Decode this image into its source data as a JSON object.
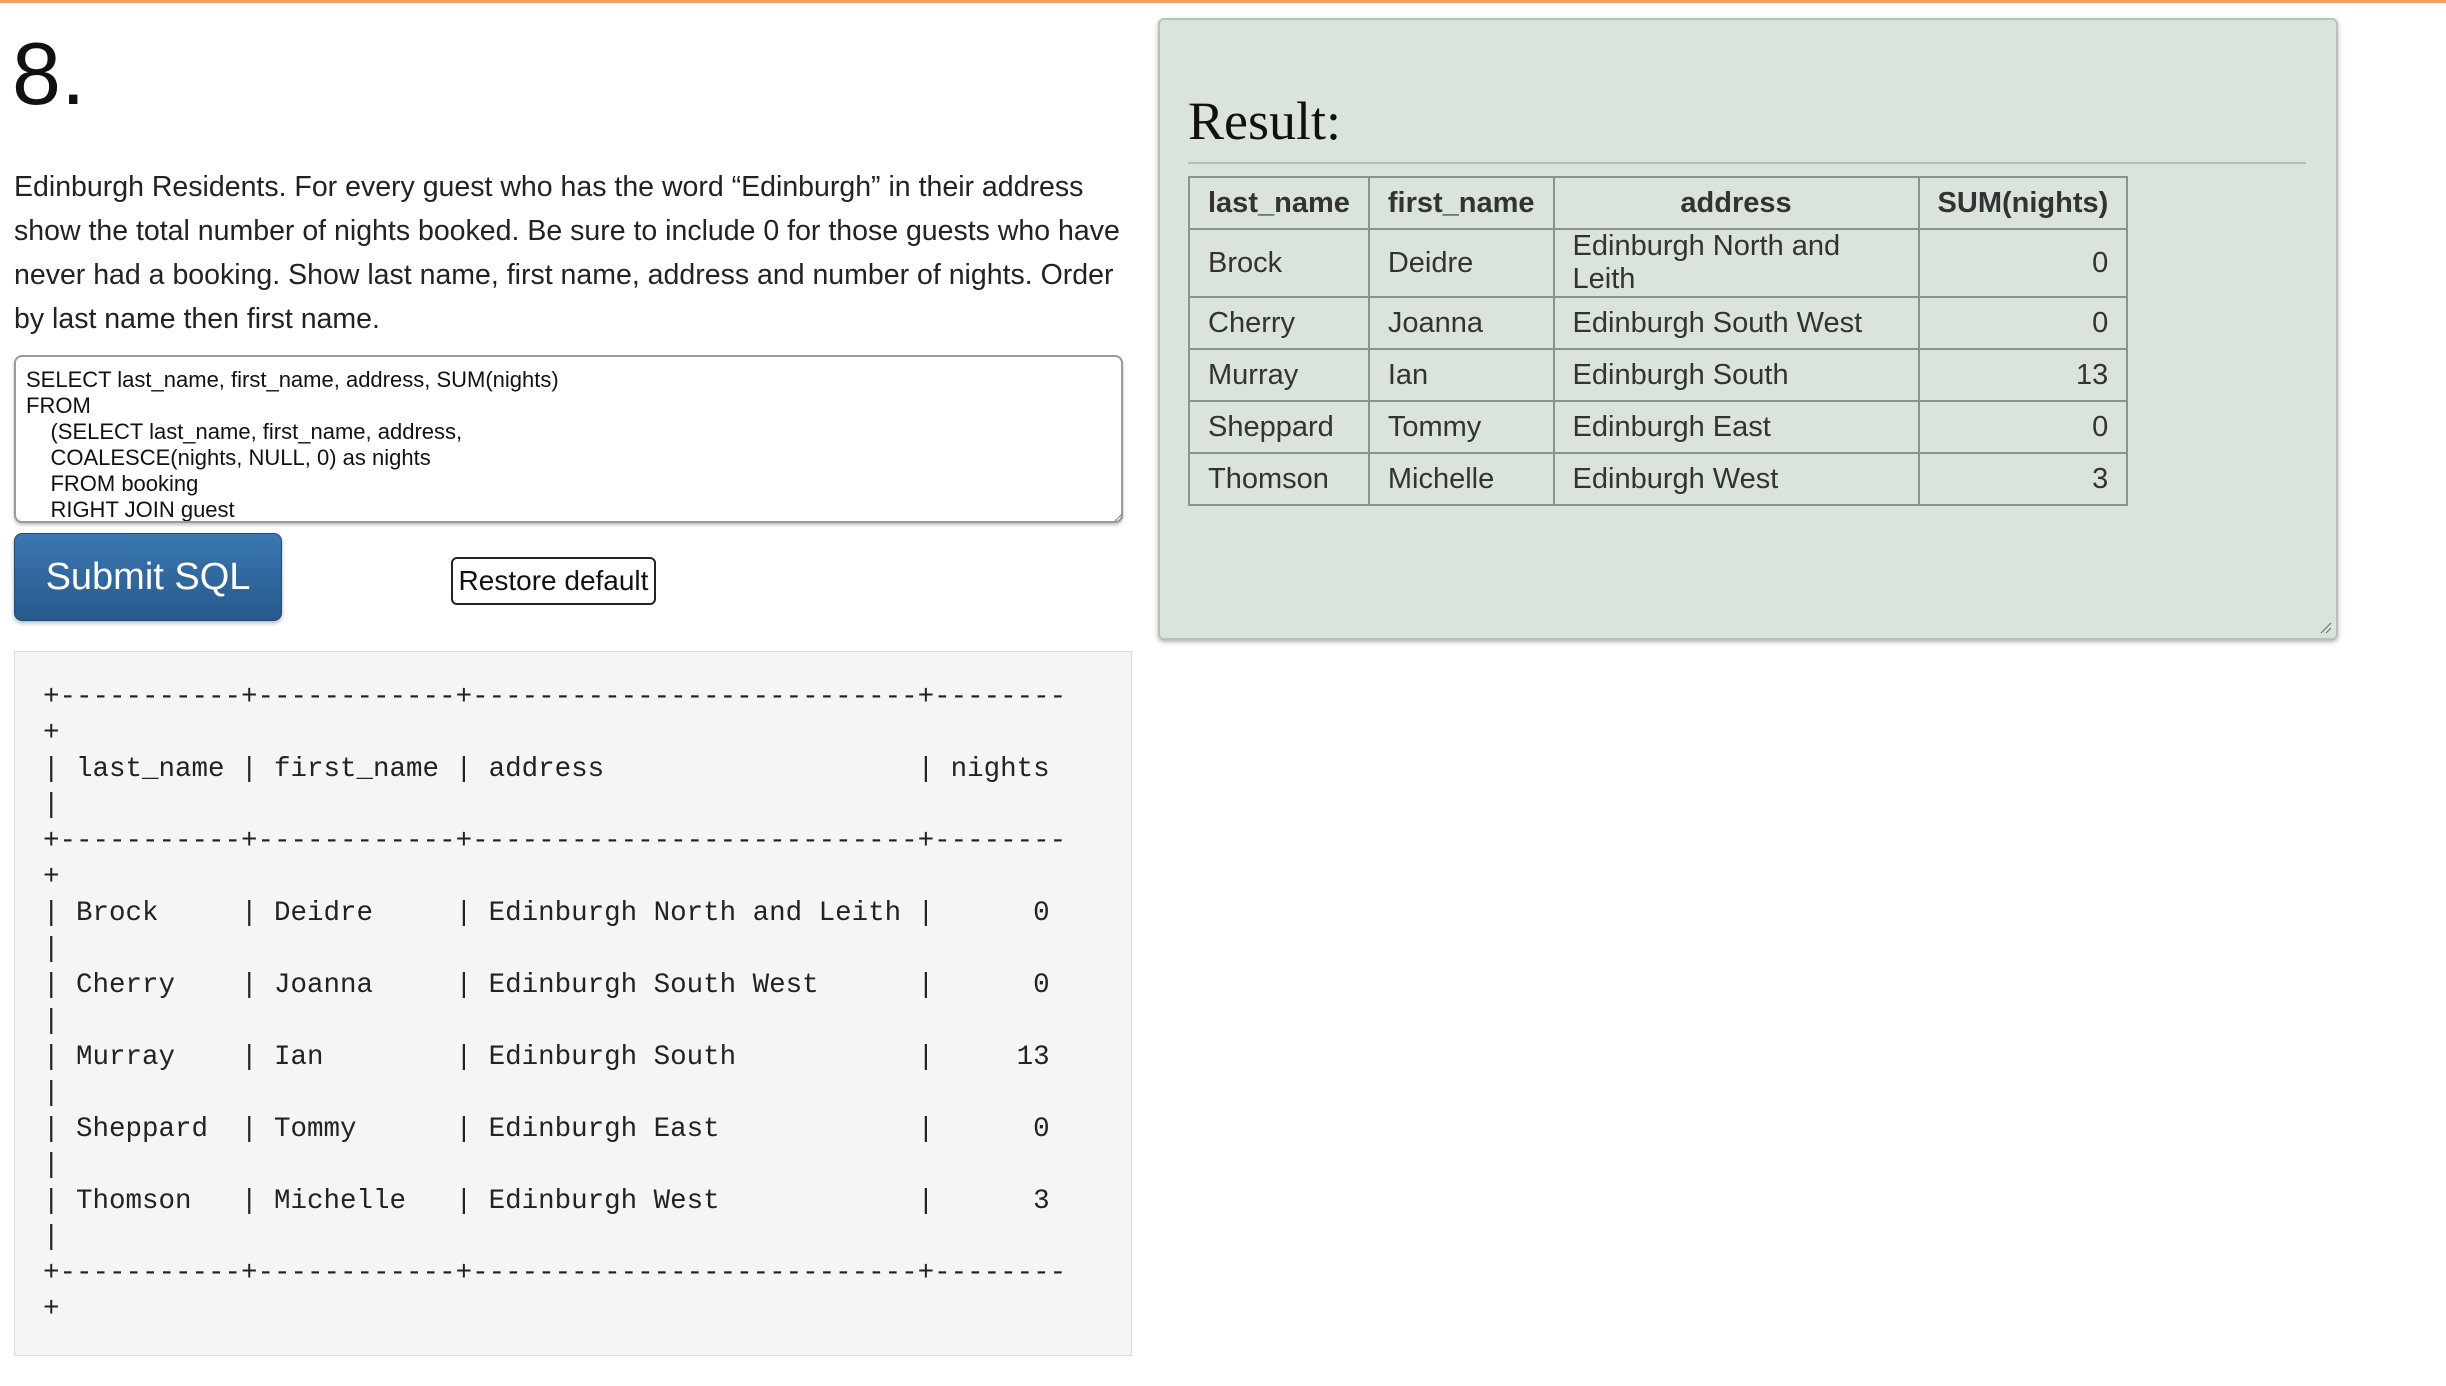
{
  "question": {
    "number": "8.",
    "description": "Edinburgh Residents. For every guest who has the word “Edinburgh” in their address show the total number of nights booked. Be sure to include 0 for those guests who have never had a booking. Show last name, first name, address and number of nights. Order by last name then first name."
  },
  "editor": {
    "sql": "SELECT last_name, first_name, address, SUM(nights)\nFROM\n    (SELECT last_name, first_name, address,\n    COALESCE(nights, NULL, 0) as nights\n    FROM booking\n    RIGHT JOIN guest\n    ON booking.guest_id = guest.id"
  },
  "buttons": {
    "submit_label": "Submit SQL",
    "restore_label": "Restore default"
  },
  "output": {
    "text": "+-----------+------------+---------------------------+--------\n+\n| last_name | first_name | address                   | nights\n|\n+-----------+------------+---------------------------+--------\n+\n| Brock     | Deidre     | Edinburgh North and Leith |      0\n|\n| Cherry    | Joanna     | Edinburgh South West      |      0\n|\n| Murray    | Ian        | Edinburgh South           |     13\n|\n| Sheppard  | Tommy      | Edinburgh East            |      0\n|\n| Thomson   | Michelle   | Edinburgh West            |      3\n|\n+-----------+------------+---------------------------+--------\n+"
  },
  "result": {
    "heading": "Result:",
    "columns": [
      "last_name",
      "first_name",
      "address",
      "SUM(nights)"
    ],
    "rows": [
      [
        "Brock",
        "Deidre",
        "Edinburgh North and Leith",
        "0"
      ],
      [
        "Cherry",
        "Joanna",
        "Edinburgh South West",
        "0"
      ],
      [
        "Murray",
        "Ian",
        "Edinburgh South",
        "13"
      ],
      [
        "Sheppard",
        "Tommy",
        "Edinburgh East",
        "0"
      ],
      [
        "Thomson",
        "Michelle",
        "Edinburgh West",
        "3"
      ]
    ]
  },
  "colors": {
    "accent_rule": "#f0a060",
    "submit_button": "#2f6aa0",
    "result_panel": "#dae4da"
  }
}
